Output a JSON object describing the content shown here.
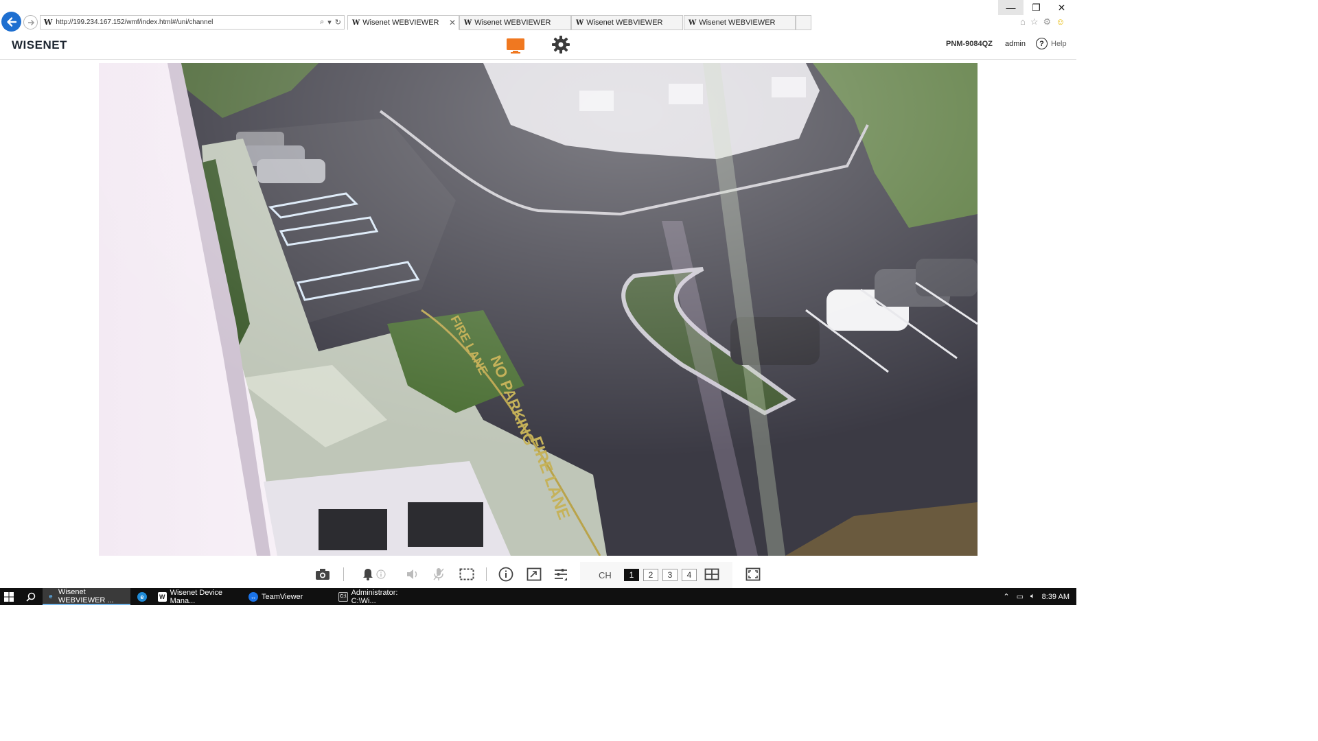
{
  "browser": {
    "url": "http://199.234.167.152/wmf/index.html#/uni/channel",
    "tabs": [
      {
        "label": "Wisenet WEBVIEWER"
      },
      {
        "label": "Wisenet WEBVIEWER"
      },
      {
        "label": "Wisenet WEBVIEWER"
      },
      {
        "label": "Wisenet WEBVIEWER"
      }
    ]
  },
  "header": {
    "logo": "WISENET",
    "model": "PNM-9084QZ",
    "user": "admin",
    "help_label": "Help"
  },
  "video": {
    "overlay_text": [
      "FIRE LANE",
      "NO PARKING",
      "FIRE LANE"
    ]
  },
  "toolbar": {
    "ch_label": "CH",
    "channels": [
      "1",
      "2",
      "3",
      "4"
    ],
    "active_channel": "1"
  },
  "taskbar": {
    "items": [
      {
        "label": "Wisenet WEBVIEWER ...",
        "icon": "ie-icon"
      },
      {
        "label": "",
        "icon": "edge-icon"
      },
      {
        "label": "Wisenet Device Mana...",
        "icon": "wisenet-icon"
      },
      {
        "label": "TeamViewer",
        "icon": "teamviewer-icon"
      },
      {
        "label": "Administrator: C:\\Wi...",
        "icon": "cmd-icon"
      }
    ],
    "clock": "8:39 AM"
  },
  "colors": {
    "accent_orange": "#f07820",
    "back_blue": "#1e6fd0",
    "taskbar": "#101010"
  }
}
